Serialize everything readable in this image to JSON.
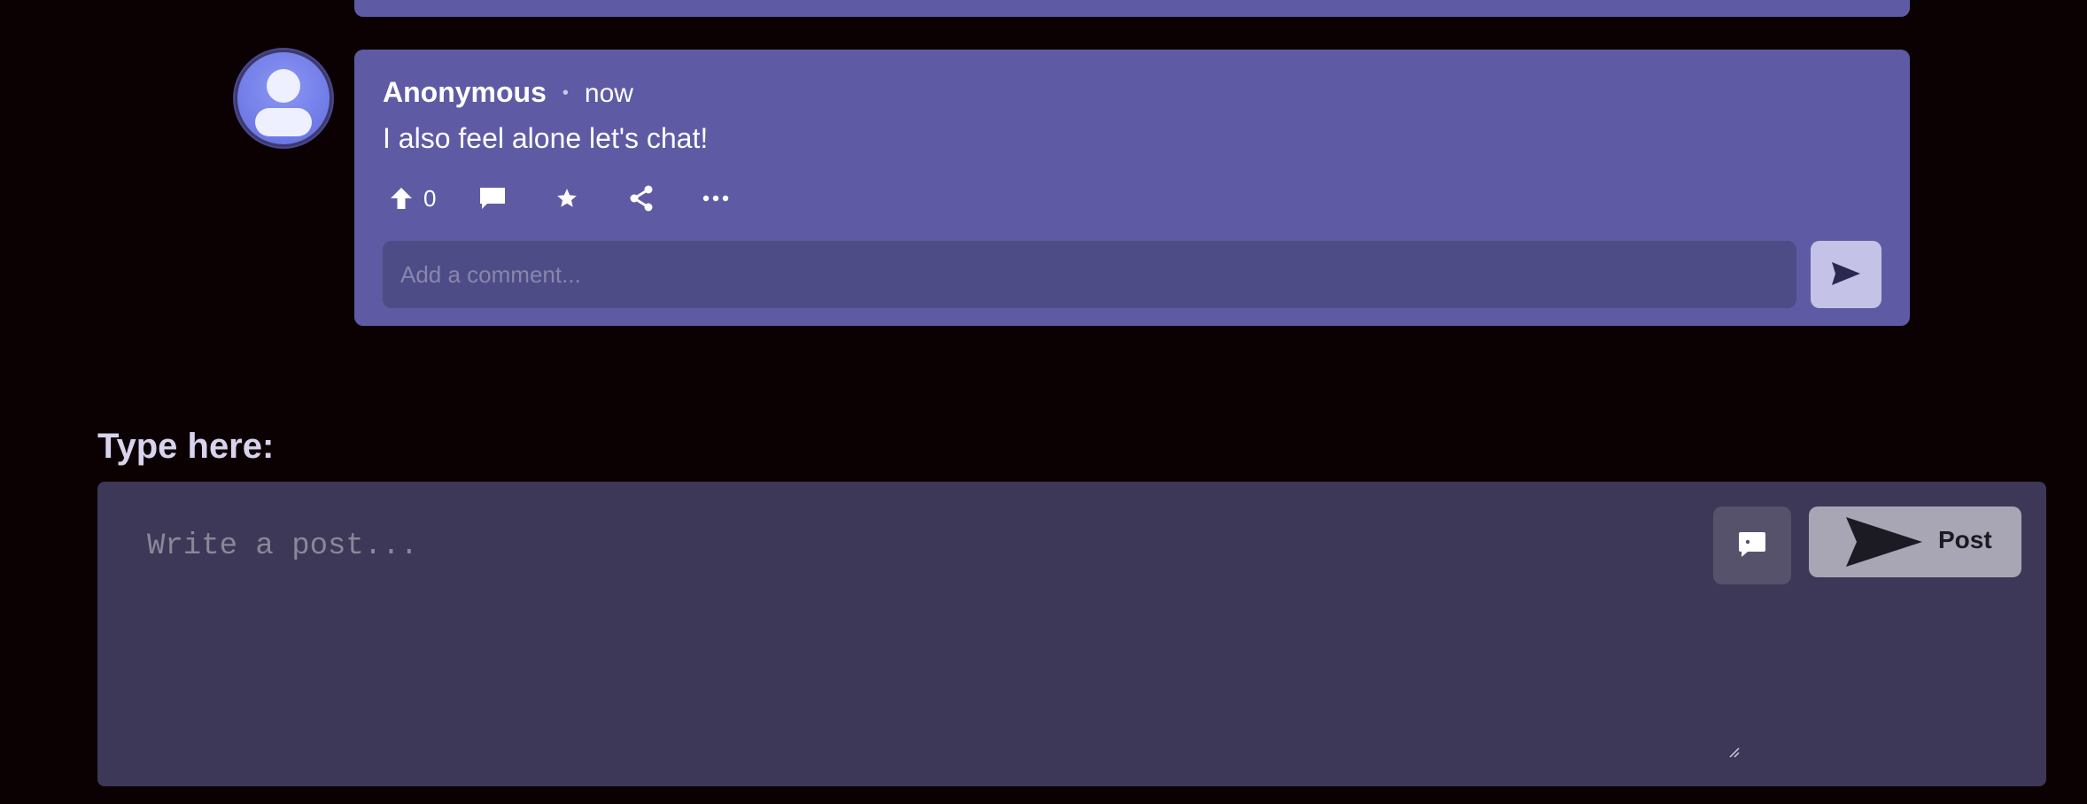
{
  "comment": {
    "author": "Anonymous",
    "separator": "•",
    "time": "now",
    "message": "I also feel alone let's chat!",
    "upvotes": "0",
    "icons": {
      "avatar": "user-avatar-icon",
      "upvote": "arrow-up-icon",
      "reply": "speech-bubble-icon",
      "favorite": "star-icon",
      "share": "share-icon",
      "more": "ellipsis-icon",
      "send": "paper-plane-icon"
    },
    "reply_input": {
      "placeholder": "Add a comment...",
      "value": ""
    }
  },
  "composer": {
    "label": "Type here:",
    "textarea": {
      "placeholder": "Write a post...",
      "value": ""
    },
    "chat_button_icon": "chat-bubble-icon",
    "post_button_label": "Post",
    "post_button_icon": "paper-plane-icon"
  },
  "colors": {
    "background": "#0b0103",
    "card": "#5e5ba4",
    "card_input": "#4e4c86",
    "composer": "#3d3857",
    "post_button": "#a8a6b4",
    "avatar": "#7a84ee"
  }
}
